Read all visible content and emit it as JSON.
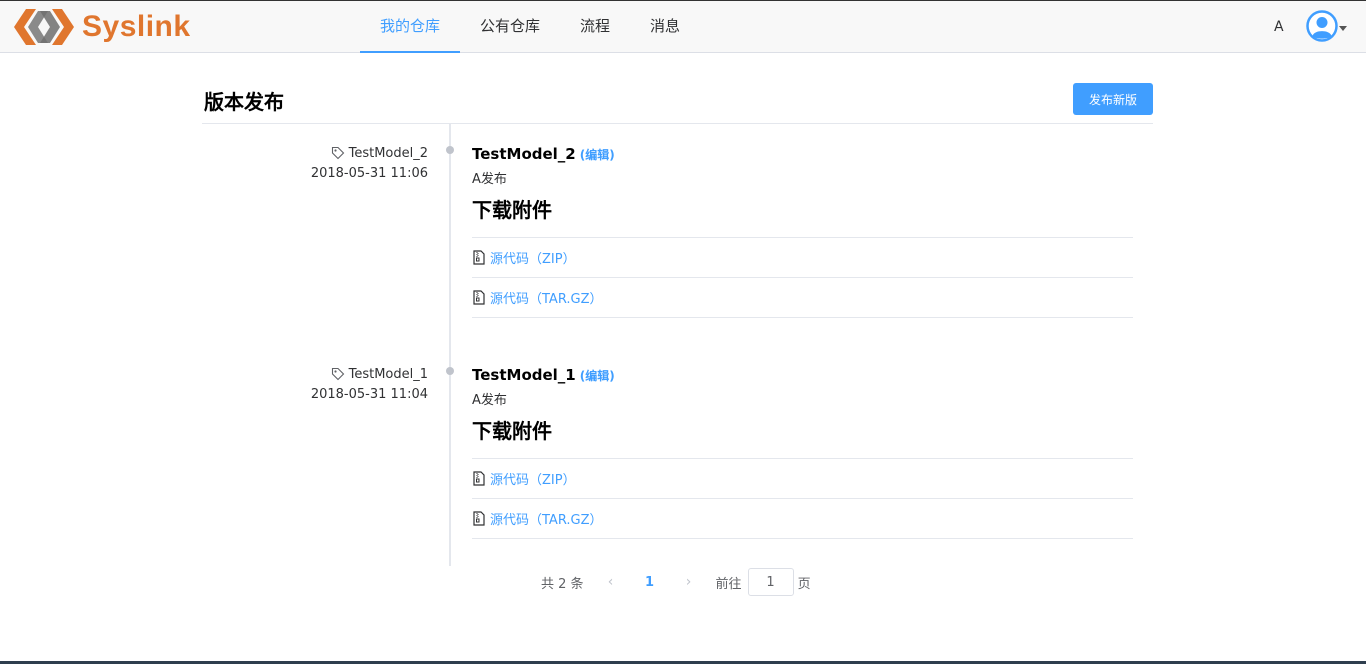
{
  "app": {
    "name": "Syslink",
    "brand_color": "#e0762e",
    "accent_color": "#409eff"
  },
  "nav": {
    "items": [
      {
        "label": "我的仓库",
        "active": true
      },
      {
        "label": "公有仓库",
        "active": false
      },
      {
        "label": "流程",
        "active": false
      },
      {
        "label": "消息",
        "active": false
      }
    ]
  },
  "user": {
    "initial": "A",
    "avatar_icon": "user-avatar-icon"
  },
  "page": {
    "title": "版本发布",
    "publish_button": "发布新版"
  },
  "releases": [
    {
      "tag": "TestModel_2",
      "date": "2018-05-31 11:06",
      "name": "TestModel_2",
      "edit_label": "(编辑)",
      "description": "A发布",
      "downloads_title": "下载附件",
      "downloads": [
        {
          "label": "源代码（ZIP）"
        },
        {
          "label": "源代码（TAR.GZ）"
        }
      ]
    },
    {
      "tag": "TestModel_1",
      "date": "2018-05-31 11:04",
      "name": "TestModel_1",
      "edit_label": "(编辑)",
      "description": "A发布",
      "downloads_title": "下载附件",
      "downloads": [
        {
          "label": "源代码（ZIP）"
        },
        {
          "label": "源代码（TAR.GZ）"
        }
      ]
    }
  ],
  "pagination": {
    "total_text": "共 2 条",
    "current_page": "1",
    "goto_prefix": "前往",
    "goto_value": "1",
    "goto_suffix": "页"
  }
}
